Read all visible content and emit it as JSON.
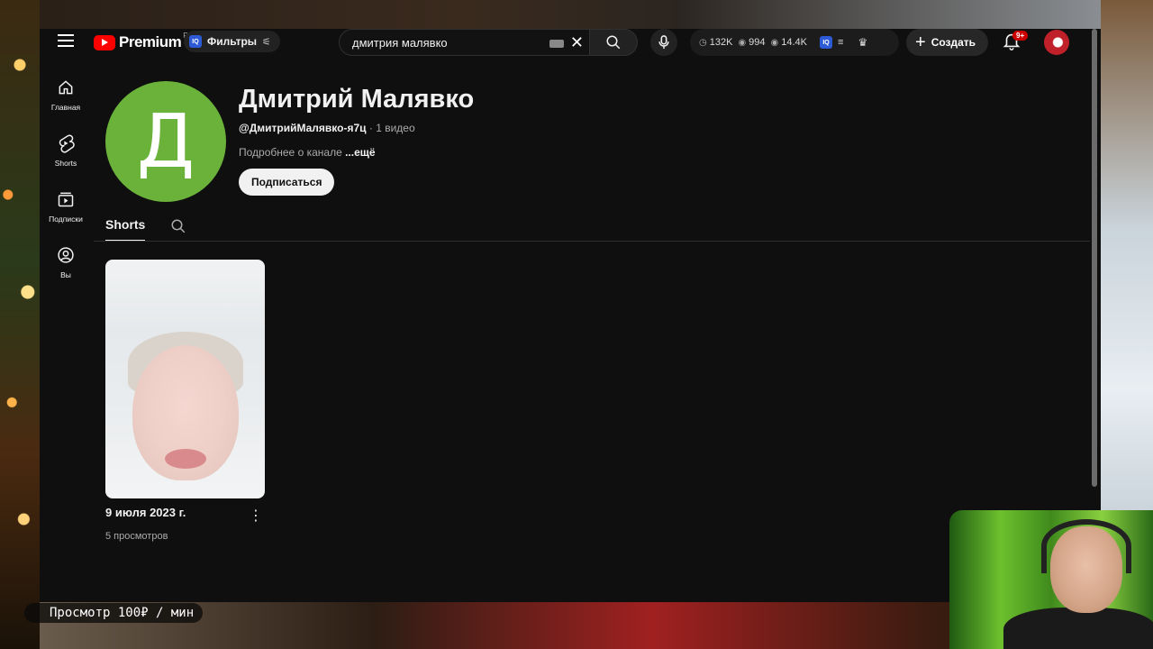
{
  "masthead": {
    "logo_text": "Premium",
    "logo_country": "RU",
    "filters_badge": "IQ",
    "filters_label": "Фильтры",
    "search_value": "дмитрия малявко",
    "stats": {
      "watch_time": "132K",
      "views": "994",
      "views2": "14.4K",
      "badge": "IQ"
    },
    "create_label": "Создать",
    "notifications_badge": "9+"
  },
  "guide": {
    "items": [
      {
        "label": "Главная",
        "icon": "home-icon"
      },
      {
        "label": "Shorts",
        "icon": "shorts-icon"
      },
      {
        "label": "Подписки",
        "icon": "subscriptions-icon"
      },
      {
        "label": "Вы",
        "icon": "user-circle-icon"
      }
    ]
  },
  "channel": {
    "avatar_letter": "Д",
    "avatar_color": "#6ab23a",
    "name": "Дмитрий Малявко",
    "handle": "@ДмитрийМалявко-я7ц",
    "separator": " · ",
    "video_count": "1 видео",
    "description": "Подробнее о канале ",
    "more_label": "...ещё",
    "subscribe_label": "Подписаться"
  },
  "tabs": {
    "active": "Shorts"
  },
  "shorts": [
    {
      "title": "9 июля 2023 г.",
      "views": "5 просмотров"
    }
  ],
  "overlay": {
    "promo_text": "Просмотр 100₽ / мин"
  }
}
